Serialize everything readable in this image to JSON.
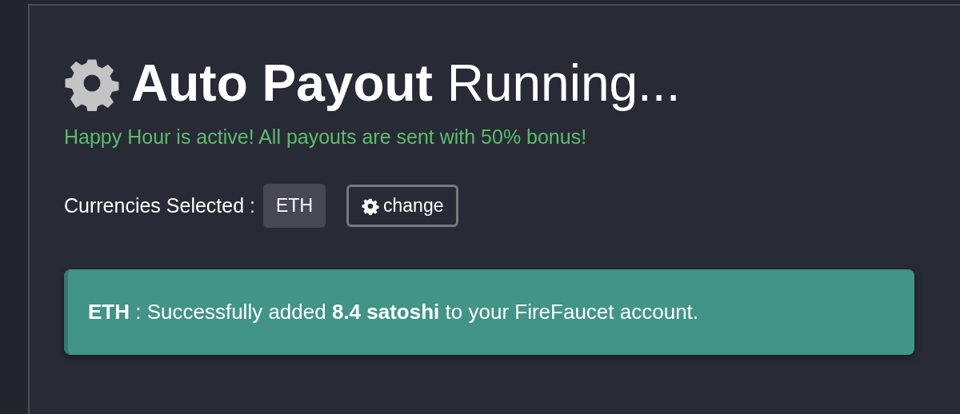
{
  "heading": "**Auto Payout** Running...",
  "notice": "Happy Hour is active! All payouts are sent with 50% bonus!",
  "currencies": {
    "label": "Currencies Selected :",
    "items": [
      "ETH"
    ],
    "button": "change"
  },
  "alerts": [
    {
      "text": "**ETH** : Successfully added **8.4 satoshi** to your FireFaucet account."
    }
  ]
}
